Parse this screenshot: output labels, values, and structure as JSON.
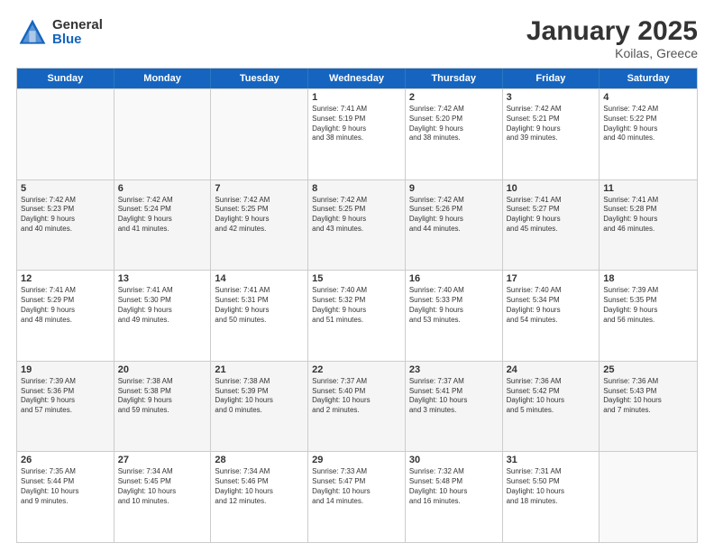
{
  "logo": {
    "general": "General",
    "blue": "Blue"
  },
  "title": "January 2025",
  "subtitle": "Koilas, Greece",
  "days": [
    "Sunday",
    "Monday",
    "Tuesday",
    "Wednesday",
    "Thursday",
    "Friday",
    "Saturday"
  ],
  "weeks": [
    [
      {
        "day": "",
        "lines": []
      },
      {
        "day": "",
        "lines": []
      },
      {
        "day": "",
        "lines": []
      },
      {
        "day": "1",
        "lines": [
          "Sunrise: 7:41 AM",
          "Sunset: 5:19 PM",
          "Daylight: 9 hours",
          "and 38 minutes."
        ]
      },
      {
        "day": "2",
        "lines": [
          "Sunrise: 7:42 AM",
          "Sunset: 5:20 PM",
          "Daylight: 9 hours",
          "and 38 minutes."
        ]
      },
      {
        "day": "3",
        "lines": [
          "Sunrise: 7:42 AM",
          "Sunset: 5:21 PM",
          "Daylight: 9 hours",
          "and 39 minutes."
        ]
      },
      {
        "day": "4",
        "lines": [
          "Sunrise: 7:42 AM",
          "Sunset: 5:22 PM",
          "Daylight: 9 hours",
          "and 40 minutes."
        ]
      }
    ],
    [
      {
        "day": "5",
        "lines": [
          "Sunrise: 7:42 AM",
          "Sunset: 5:23 PM",
          "Daylight: 9 hours",
          "and 40 minutes."
        ]
      },
      {
        "day": "6",
        "lines": [
          "Sunrise: 7:42 AM",
          "Sunset: 5:24 PM",
          "Daylight: 9 hours",
          "and 41 minutes."
        ]
      },
      {
        "day": "7",
        "lines": [
          "Sunrise: 7:42 AM",
          "Sunset: 5:25 PM",
          "Daylight: 9 hours",
          "and 42 minutes."
        ]
      },
      {
        "day": "8",
        "lines": [
          "Sunrise: 7:42 AM",
          "Sunset: 5:25 PM",
          "Daylight: 9 hours",
          "and 43 minutes."
        ]
      },
      {
        "day": "9",
        "lines": [
          "Sunrise: 7:42 AM",
          "Sunset: 5:26 PM",
          "Daylight: 9 hours",
          "and 44 minutes."
        ]
      },
      {
        "day": "10",
        "lines": [
          "Sunrise: 7:41 AM",
          "Sunset: 5:27 PM",
          "Daylight: 9 hours",
          "and 45 minutes."
        ]
      },
      {
        "day": "11",
        "lines": [
          "Sunrise: 7:41 AM",
          "Sunset: 5:28 PM",
          "Daylight: 9 hours",
          "and 46 minutes."
        ]
      }
    ],
    [
      {
        "day": "12",
        "lines": [
          "Sunrise: 7:41 AM",
          "Sunset: 5:29 PM",
          "Daylight: 9 hours",
          "and 48 minutes."
        ]
      },
      {
        "day": "13",
        "lines": [
          "Sunrise: 7:41 AM",
          "Sunset: 5:30 PM",
          "Daylight: 9 hours",
          "and 49 minutes."
        ]
      },
      {
        "day": "14",
        "lines": [
          "Sunrise: 7:41 AM",
          "Sunset: 5:31 PM",
          "Daylight: 9 hours",
          "and 50 minutes."
        ]
      },
      {
        "day": "15",
        "lines": [
          "Sunrise: 7:40 AM",
          "Sunset: 5:32 PM",
          "Daylight: 9 hours",
          "and 51 minutes."
        ]
      },
      {
        "day": "16",
        "lines": [
          "Sunrise: 7:40 AM",
          "Sunset: 5:33 PM",
          "Daylight: 9 hours",
          "and 53 minutes."
        ]
      },
      {
        "day": "17",
        "lines": [
          "Sunrise: 7:40 AM",
          "Sunset: 5:34 PM",
          "Daylight: 9 hours",
          "and 54 minutes."
        ]
      },
      {
        "day": "18",
        "lines": [
          "Sunrise: 7:39 AM",
          "Sunset: 5:35 PM",
          "Daylight: 9 hours",
          "and 56 minutes."
        ]
      }
    ],
    [
      {
        "day": "19",
        "lines": [
          "Sunrise: 7:39 AM",
          "Sunset: 5:36 PM",
          "Daylight: 9 hours",
          "and 57 minutes."
        ]
      },
      {
        "day": "20",
        "lines": [
          "Sunrise: 7:38 AM",
          "Sunset: 5:38 PM",
          "Daylight: 9 hours",
          "and 59 minutes."
        ]
      },
      {
        "day": "21",
        "lines": [
          "Sunrise: 7:38 AM",
          "Sunset: 5:39 PM",
          "Daylight: 10 hours",
          "and 0 minutes."
        ]
      },
      {
        "day": "22",
        "lines": [
          "Sunrise: 7:37 AM",
          "Sunset: 5:40 PM",
          "Daylight: 10 hours",
          "and 2 minutes."
        ]
      },
      {
        "day": "23",
        "lines": [
          "Sunrise: 7:37 AM",
          "Sunset: 5:41 PM",
          "Daylight: 10 hours",
          "and 3 minutes."
        ]
      },
      {
        "day": "24",
        "lines": [
          "Sunrise: 7:36 AM",
          "Sunset: 5:42 PM",
          "Daylight: 10 hours",
          "and 5 minutes."
        ]
      },
      {
        "day": "25",
        "lines": [
          "Sunrise: 7:36 AM",
          "Sunset: 5:43 PM",
          "Daylight: 10 hours",
          "and 7 minutes."
        ]
      }
    ],
    [
      {
        "day": "26",
        "lines": [
          "Sunrise: 7:35 AM",
          "Sunset: 5:44 PM",
          "Daylight: 10 hours",
          "and 9 minutes."
        ]
      },
      {
        "day": "27",
        "lines": [
          "Sunrise: 7:34 AM",
          "Sunset: 5:45 PM",
          "Daylight: 10 hours",
          "and 10 minutes."
        ]
      },
      {
        "day": "28",
        "lines": [
          "Sunrise: 7:34 AM",
          "Sunset: 5:46 PM",
          "Daylight: 10 hours",
          "and 12 minutes."
        ]
      },
      {
        "day": "29",
        "lines": [
          "Sunrise: 7:33 AM",
          "Sunset: 5:47 PM",
          "Daylight: 10 hours",
          "and 14 minutes."
        ]
      },
      {
        "day": "30",
        "lines": [
          "Sunrise: 7:32 AM",
          "Sunset: 5:48 PM",
          "Daylight: 10 hours",
          "and 16 minutes."
        ]
      },
      {
        "day": "31",
        "lines": [
          "Sunrise: 7:31 AM",
          "Sunset: 5:50 PM",
          "Daylight: 10 hours",
          "and 18 minutes."
        ]
      },
      {
        "day": "",
        "lines": []
      }
    ]
  ]
}
